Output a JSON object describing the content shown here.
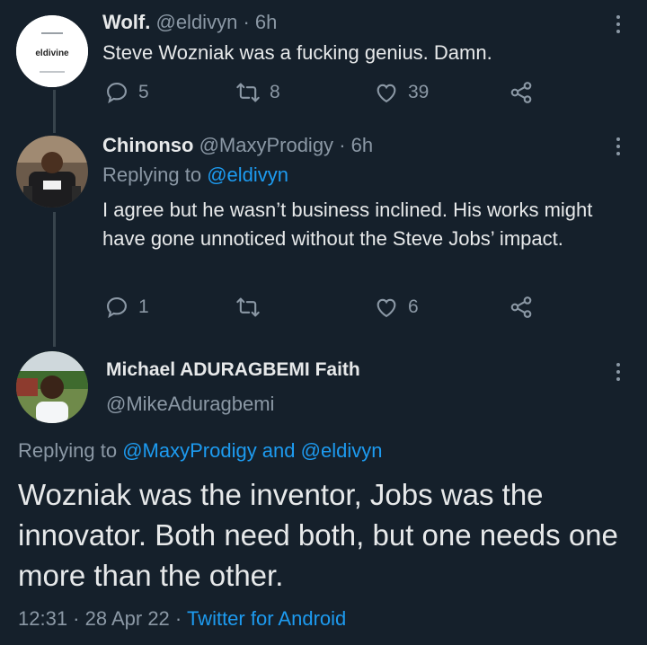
{
  "tweets": [
    {
      "name": "Wolf.",
      "handle": "@eldivyn",
      "time": "· 6h",
      "text": "Steve Wozniak was a fucking genius. Damn.",
      "avatar_brand": "eldivine",
      "counts": {
        "replies": "5",
        "retweets": "8",
        "likes": "39"
      }
    },
    {
      "name": "Chinonso",
      "handle": "@MaxyProdigy",
      "time": "· 6h",
      "replying_prefix": "Replying to",
      "replying_to": "@eldivyn",
      "text": "I agree but he wasn’t business inclined. His works might have gone unnoticed without the Steve Jobs’ impact.",
      "counts": {
        "replies": "1",
        "retweets": "",
        "likes": "6"
      }
    }
  ],
  "main": {
    "name": "Michael ADURAGBEMI Faith",
    "handle": "@MikeAduragbemi",
    "replying_prefix": "Replying to",
    "replying_to": "@MaxyProdigy and @eldivyn",
    "text": "Wozniak was the inventor, Jobs was the innovator. Both need both, but one needs one more than the other.",
    "timestamp": "12:31 · 28 Apr 22 ·",
    "source": "Twitter for Android"
  },
  "colors": {
    "background": "#15202b",
    "text": "#e7e9ea",
    "muted": "#8b98a5",
    "accent": "#1d9bf0",
    "line": "#38444d"
  }
}
